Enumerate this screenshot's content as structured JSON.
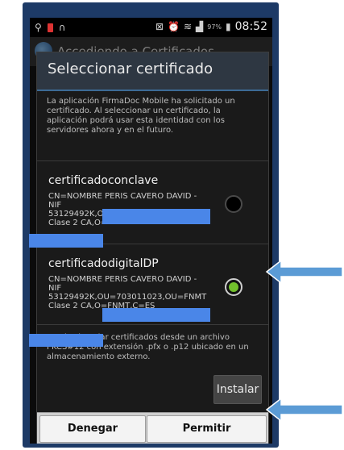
{
  "status_bar": {
    "battery_pct": "97%",
    "time": "08:52"
  },
  "app": {
    "title": "Accediendo a Certificados"
  },
  "dialog": {
    "title": "Seleccionar certificado",
    "message": "La aplicación FirmaDoc Mobile ha solicitado un certificado. Al seleccionar un certificado, la aplicación podrá usar esta identidad con los servidores ahora y en el futuro.",
    "certificates": [
      {
        "name": "certificadoconclave",
        "detail": "CN=NOMBRE PERIS CAVERO DAVID -\nNIF\n53129492K,OU=703011023,OU=FNMT\nClase 2 CA,O=",
        "selected": false
      },
      {
        "name": "certificadodigitalDP",
        "detail": "CN=NOMBRE PERIS CAVERO DAVID -\nNIF\n53129492K,OU=703011023,OU=FNMT\nClase 2 CA,O=FNMT,C=ES",
        "selected": true
      }
    ],
    "install_message": "Puedes instalar certificados desde un archivo PKCS#12 con extensión .pfx o .p12 ubicado en un almacenamiento externo.",
    "install_label": "Instalar",
    "deny_label": "Denegar",
    "allow_label": "Permitir"
  },
  "colors": {
    "frame": "#1d3a66",
    "redaction": "#4a86e8",
    "arrow": "#5b9bd5",
    "radio_selected": "#72c02c"
  }
}
